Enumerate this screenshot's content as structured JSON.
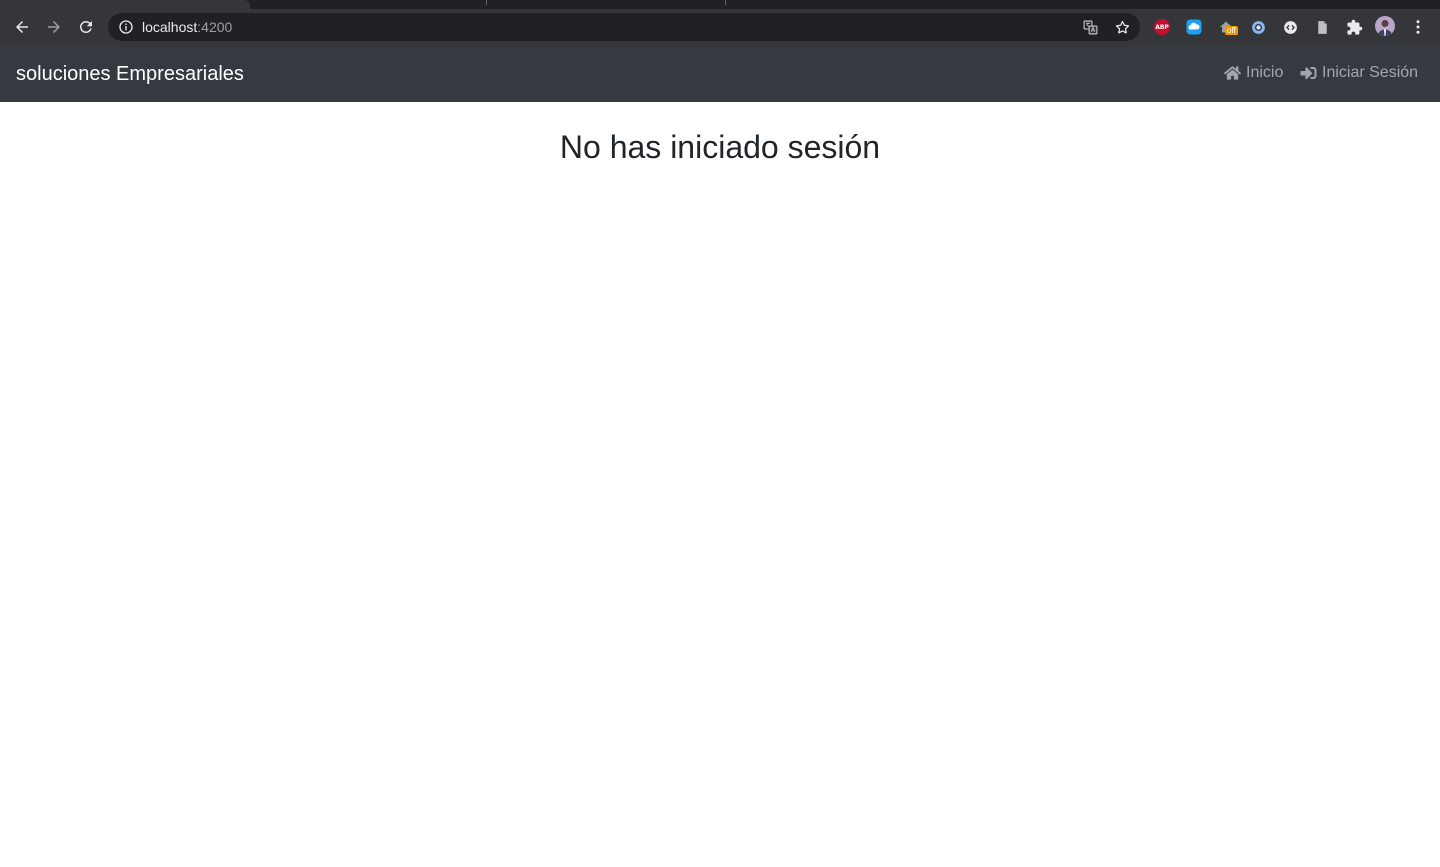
{
  "browser": {
    "url_host": "localhost",
    "url_port": ":4200",
    "extensions": {
      "abp_label": "ABP",
      "off_badge": "off"
    }
  },
  "navbar": {
    "brand": "soluciones Empresariales",
    "links": [
      {
        "label": "Inicio",
        "icon": "home-icon"
      },
      {
        "label": "Iniciar Sesión",
        "icon": "sign-in-icon"
      }
    ],
    "background": "#343a40"
  },
  "main": {
    "title": "No has iniciado sesión"
  }
}
